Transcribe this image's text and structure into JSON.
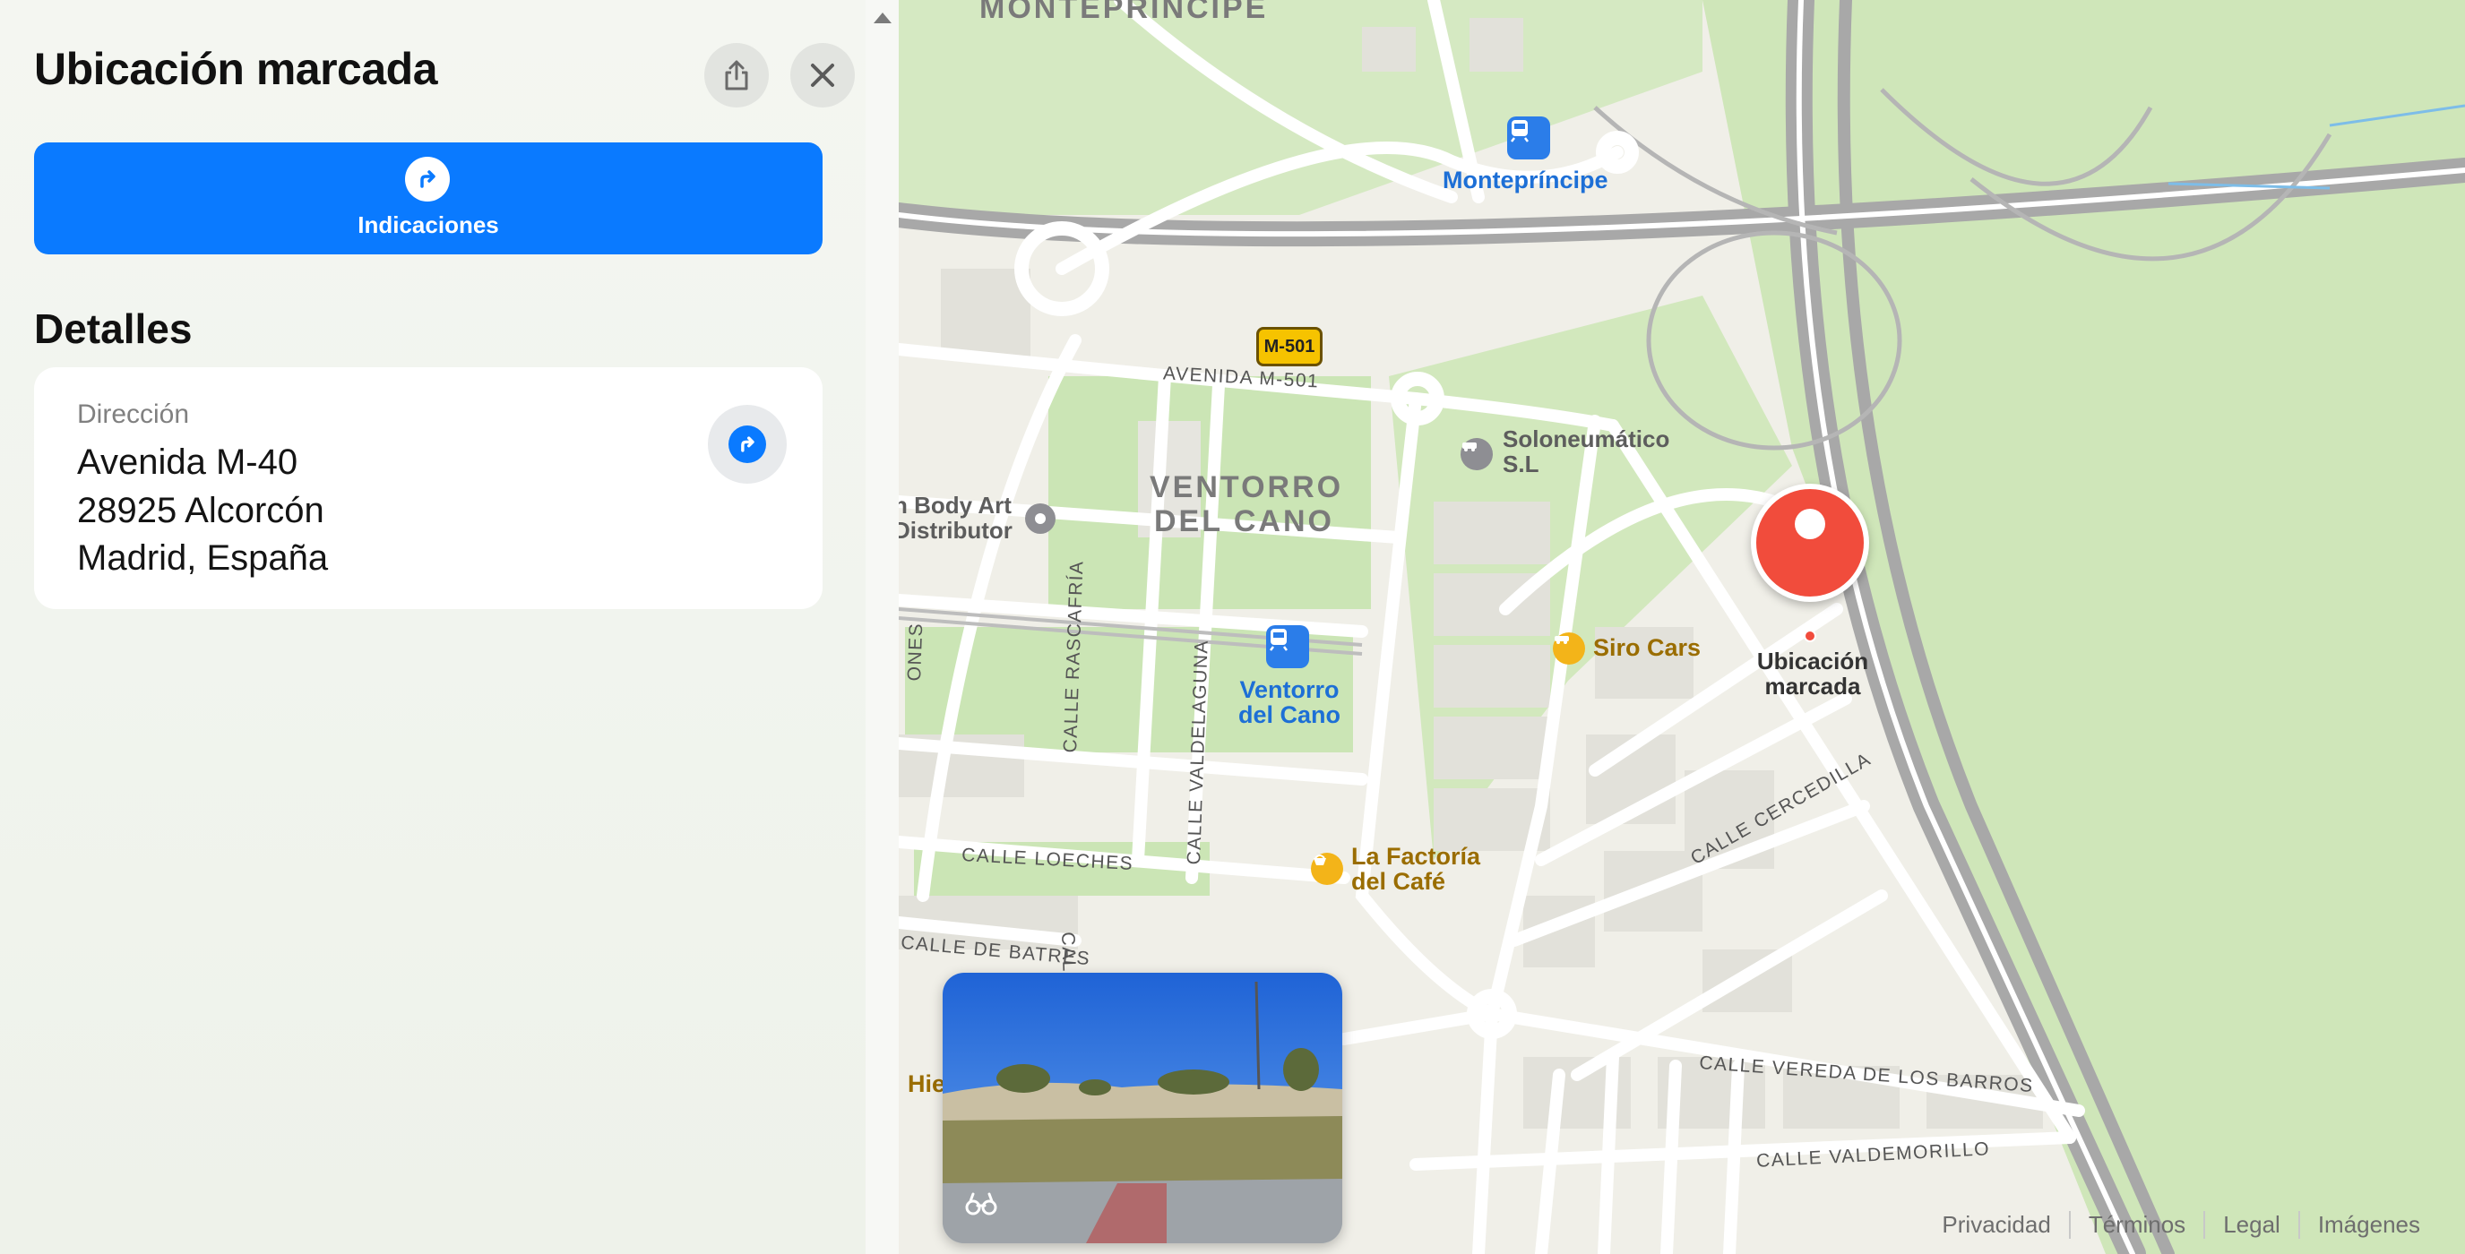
{
  "panel": {
    "title": "Ubicación marcada",
    "directions_label": "Indicaciones",
    "details_title": "Detalles",
    "address": {
      "label": "Dirección",
      "lines": [
        "Avenida M-40",
        "28925 Alcorcón",
        "Madrid, España"
      ]
    }
  },
  "map": {
    "district_top": "MONTEPRÍNCIPE",
    "district_main": [
      "VENTORRO",
      "DEL CANO"
    ],
    "road_shield": "M-501",
    "streets": {
      "avenida_m501": "AVENIDA M-501",
      "calle_loeches": "CALLE LOECHES",
      "calle_de_batres": "CALLE DE BATRES",
      "calle_rascafria": "CALLE RASCAFRÍA",
      "calle_valdelaguna": "CALLE VALDELAGUNA",
      "calle_cercedilla": "CALLE CERCEDILLA",
      "calle_vereda": "CALLE VEREDA DE LOS BARROS",
      "calle_valdemorillo": "CALLE VALDEMORILLO",
      "calle_partial": "CALLE",
      "ones_partial": "ONES"
    },
    "pois": {
      "monteprincipe": "Montepríncipe",
      "ventorro": [
        "Ventorro",
        "del Cano"
      ],
      "soloneumatico": [
        "Soloneumático",
        "S.L"
      ],
      "body_art": [
        "n Body Art",
        "Distributor"
      ],
      "siro_cars": "Siro Cars",
      "factoria": [
        "La Factoría",
        "del Café"
      ],
      "hie_partial": "Hie"
    },
    "pin_label": [
      "Ubicación",
      "marcada"
    ],
    "colors": {
      "park": "#c9e2b3",
      "land": "#f1f0ea",
      "road": "#ffffff",
      "highway": "#a0a0a0",
      "accent": "#0a7aff",
      "pin": "#f14c3c"
    }
  },
  "footer": {
    "links": [
      "Privacidad",
      "Términos",
      "Legal",
      "Imágenes"
    ]
  }
}
